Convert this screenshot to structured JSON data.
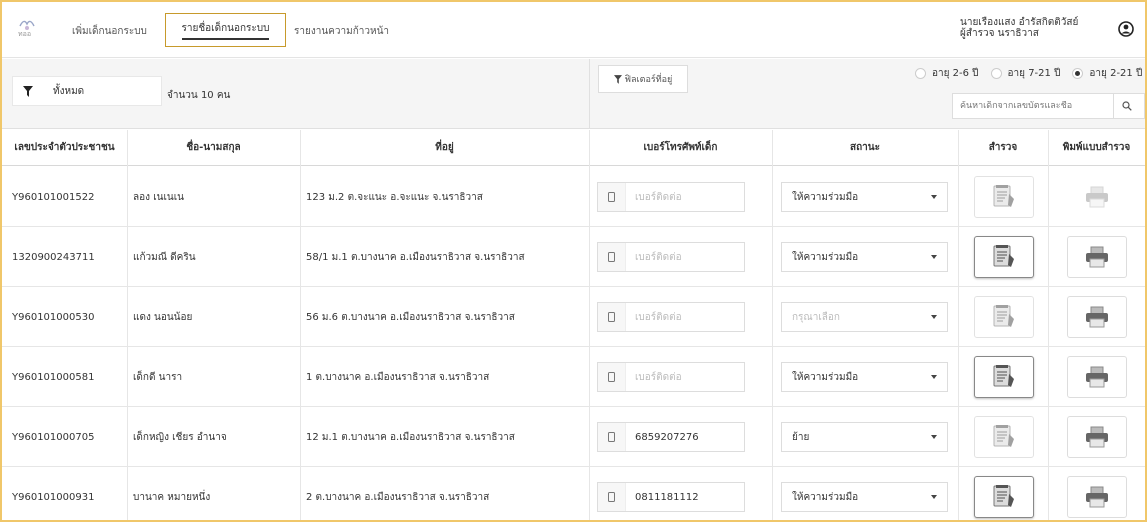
{
  "colors": {
    "accent": "#c79a2b",
    "frame": "#f0c76a"
  },
  "nav": {
    "logo_text": "ทออ",
    "items": [
      "เพิ่มเด็กนอกระบบ",
      "รายชื่อเด็กนอกระบบ",
      "รายงานความก้าวหน้า"
    ],
    "user_line1": "นายเรืองแสง อำรัสกิตติวัสย์",
    "user_line2": "ผู้สำรวจ นราธิวาส"
  },
  "toolbar": {
    "filter_value": "ทั้งหมด",
    "count_text": "จำนวน 10 คน",
    "address_filter_label": "ฟิลเตอร์ที่อยู่",
    "age_options": [
      "อายุ 2-6 ปี",
      "อายุ 7-21 ปี",
      "อายุ 2-21 ปี"
    ],
    "age_selected": "อายุ 2-21 ปี",
    "search_placeholder": "ค้นหาเด็กจากเลขบัตรและชื่อ"
  },
  "table": {
    "headers": [
      "เลขประจำตัวประชาชน",
      "ชื่อ-นามสกุล",
      "ที่อยู่",
      "เบอร์โทรศัพท์เด็ก",
      "สถานะ",
      "สำรวจ",
      "พิมพ์แบบสำรวจ"
    ],
    "phone_placeholder": "เบอร์ติดต่อ",
    "status_placeholder": "กรุณาเลือก",
    "rows": [
      {
        "id": "Y960101001522",
        "name": "ลอง เนเนเน",
        "address": "123 ม.2 ต.จะแนะ อ.จะแนะ จ.นราธิวาส",
        "phone": "",
        "status": "ให้ความร่วมมือ",
        "survey_active": false,
        "print_enabled": false
      },
      {
        "id": "1320900243711",
        "name": "แก้วมณี ดีคริน",
        "address": "58/1 ม.1 ต.บางนาค อ.เมืองนราธิวาส จ.นราธิวาส",
        "phone": "",
        "status": "ให้ความร่วมมือ",
        "survey_active": true,
        "print_enabled": true
      },
      {
        "id": "Y960101000530",
        "name": "แดง นอนน้อย",
        "address": "56 ม.6 ต.บางนาค อ.เมืองนราธิวาส จ.นราธิวาส",
        "phone": "",
        "status": "",
        "survey_active": false,
        "print_enabled": true
      },
      {
        "id": "Y960101000581",
        "name": "เด็กดี นารา",
        "address": "1 ต.บางนาค อ.เมืองนราธิวาส จ.นราธิวาส",
        "phone": "",
        "status": "ให้ความร่วมมือ",
        "survey_active": true,
        "print_enabled": true
      },
      {
        "id": "Y960101000705",
        "name": "เด็กหญิง เชียร อำนาจ",
        "address": "12 ม.1 ต.บางนาค อ.เมืองนราธิวาส จ.นราธิวาส",
        "phone": "6859207276",
        "status": "ย้าย",
        "survey_active": false,
        "print_enabled": true
      },
      {
        "id": "Y960101000931",
        "name": "บานาค หมายหนึ่ง",
        "address": "2 ต.บางนาค อ.เมืองนราธิวาส จ.นราธิวาส",
        "phone": "0811181112",
        "status": "ให้ความร่วมมือ",
        "survey_active": true,
        "print_enabled": true
      }
    ]
  }
}
